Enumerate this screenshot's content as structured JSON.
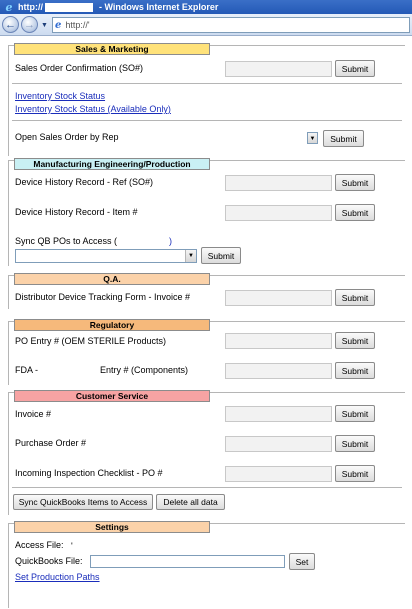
{
  "window": {
    "title_prefix": "http://",
    "title_suffix": "- Windows Internet Explorer",
    "url": "http://'"
  },
  "colors": {
    "sales": "#ffe27a",
    "manufacturing": "#c9f0f4",
    "qa": "#fbd2a9",
    "regulatory": "#f6b97b",
    "customer_service": "#f7a3a3",
    "settings": "#fbd2a9",
    "link": "#1a2dbb"
  },
  "sales": {
    "header": "Sales & Marketing",
    "so_confirmation_label": "Sales Order Confirmation (SO#)",
    "submit": "Submit",
    "inventory_link": "Inventory Stock Status",
    "inventory_available_link": "Inventory Stock Status (Available Only)",
    "open_so_label": "Open Sales Order by Rep",
    "open_so_submit": "Submit"
  },
  "manufacturing": {
    "header": "Manufacturing Engineering/Production",
    "dhr_ref_label": "Device History Record - Ref (SO#)",
    "dhr_item_label": "Device History Record - Item #",
    "sync_label": "Sync QB POs to Access (",
    "sync_paren": ")",
    "submit": "Submit"
  },
  "qa": {
    "header": "Q.A.",
    "distributor_label": "Distributor Device Tracking Form - Invoice #",
    "submit": "Submit"
  },
  "regulatory": {
    "header": "Regulatory",
    "po_entry_label": "PO Entry # (OEM STERILE Products)",
    "fda_label": "FDA -",
    "entry_components_label": "Entry # (Components)",
    "submit": "Submit"
  },
  "customer_service": {
    "header": "Customer Service",
    "invoice_label": "Invoice #",
    "po_label": "Purchase Order #",
    "incoming_label": "Incoming Inspection Checklist - PO #",
    "submit": "Submit",
    "sync_items_button": "Sync QuickBooks Items to Access",
    "delete_all_button": "Delete all data"
  },
  "settings": {
    "header": "Settings",
    "access_file_label": "Access File:",
    "access_file_value": "'",
    "quickbooks_file_label": "QuickBooks File:",
    "set_button": "Set",
    "production_paths_link": "Set Production Paths"
  }
}
